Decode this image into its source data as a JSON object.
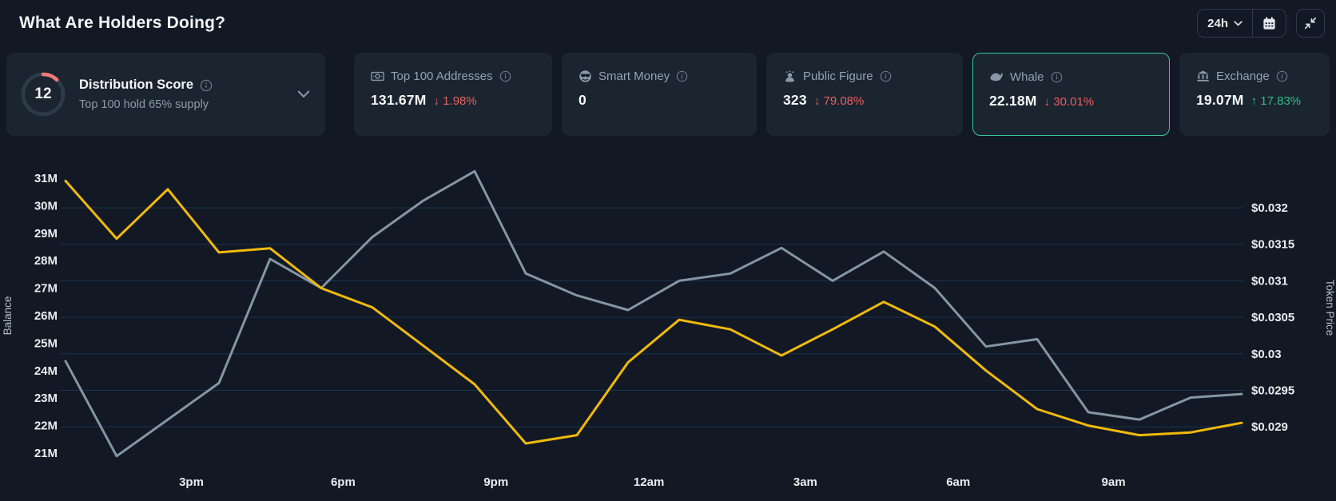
{
  "colors": {
    "down_red": "#ec5f5f",
    "up_green": "#2ebd85",
    "selected_card_border": "#35c79b",
    "balance_line": "#f0b90b",
    "price_line": "#8496a5",
    "gauge_arc": "#f07a7a",
    "gauge_track": "#2d3b49"
  },
  "header": {
    "title": "What Are Holders Doing?",
    "timeframe": "24h"
  },
  "distribution": {
    "score": "12",
    "score_pct": 12,
    "title": "Distribution Score",
    "subtitle": "Top 100 hold 65% supply"
  },
  "stats": [
    {
      "label": "Top 100 Addresses",
      "value": "131.67M",
      "change": "↓ 1.98%",
      "direction": "down",
      "selected": false
    },
    {
      "label": "Smart Money",
      "value": "0",
      "change": "",
      "direction": "none",
      "selected": false
    },
    {
      "label": "Public Figure",
      "value": "323",
      "change": "↓ 79.08%",
      "direction": "down",
      "selected": false
    },
    {
      "label": "Whale",
      "value": "22.18M",
      "change": "↓ 30.01%",
      "direction": "down",
      "selected": true
    },
    {
      "label": "Exchange",
      "value": "19.07M",
      "change": "↑ 17.83%",
      "direction": "up",
      "selected": false
    }
  ],
  "chart_data": {
    "type": "line",
    "title": "What Are Holders Doing?",
    "timeframe": "24h",
    "grid": "horizontal, aligned to right-axis ticks",
    "legend_position": "none",
    "x_ticks": [
      {
        "label": "3pm",
        "frac": 0.107
      },
      {
        "label": "6pm",
        "frac": 0.236
      },
      {
        "label": "9pm",
        "frac": 0.366
      },
      {
        "label": "12am",
        "frac": 0.496
      },
      {
        "label": "3am",
        "frac": 0.629
      },
      {
        "label": "6am",
        "frac": 0.759
      },
      {
        "label": "9am",
        "frac": 0.891
      }
    ],
    "left_axis": {
      "label": "Balance",
      "ticks": [
        "31M",
        "30M",
        "29M",
        "28M",
        "27M",
        "26M",
        "25M",
        "24M",
        "23M",
        "22M",
        "21M"
      ],
      "max": 31,
      "min": 21,
      "unit": "M tokens"
    },
    "right_axis": {
      "label": "Token Price",
      "ticks": [
        "$0.032",
        "$0.0315",
        "$0.031",
        "$0.0305",
        "$0.03",
        "$0.0295",
        "$0.029"
      ],
      "max": 0.032,
      "min": 0.029,
      "tick_step": 0.0005
    },
    "series": [
      {
        "name": "Token Price",
        "axis": "right",
        "color_key": "price_line",
        "values": [
          0.0299,
          0.0286,
          0.0291,
          0.0296,
          0.0313,
          0.0309,
          0.0316,
          0.0321,
          0.0325,
          0.0311,
          0.0308,
          0.0306,
          0.031,
          0.0311,
          0.03145,
          0.031,
          0.0314,
          0.0309,
          0.0301,
          0.0302,
          0.0292,
          0.0291,
          0.0294,
          0.02945
        ]
      },
      {
        "name": "Whale Balance",
        "axis": "left",
        "color_key": "balance_line",
        "values": [
          30.9,
          28.8,
          30.6,
          28.3,
          28.45,
          27.0,
          26.3,
          24.9,
          23.5,
          21.35,
          21.65,
          24.3,
          25.85,
          25.5,
          24.55,
          25.5,
          26.5,
          25.6,
          24.0,
          22.6,
          22.0,
          21.65,
          21.75,
          22.1
        ]
      }
    ]
  }
}
